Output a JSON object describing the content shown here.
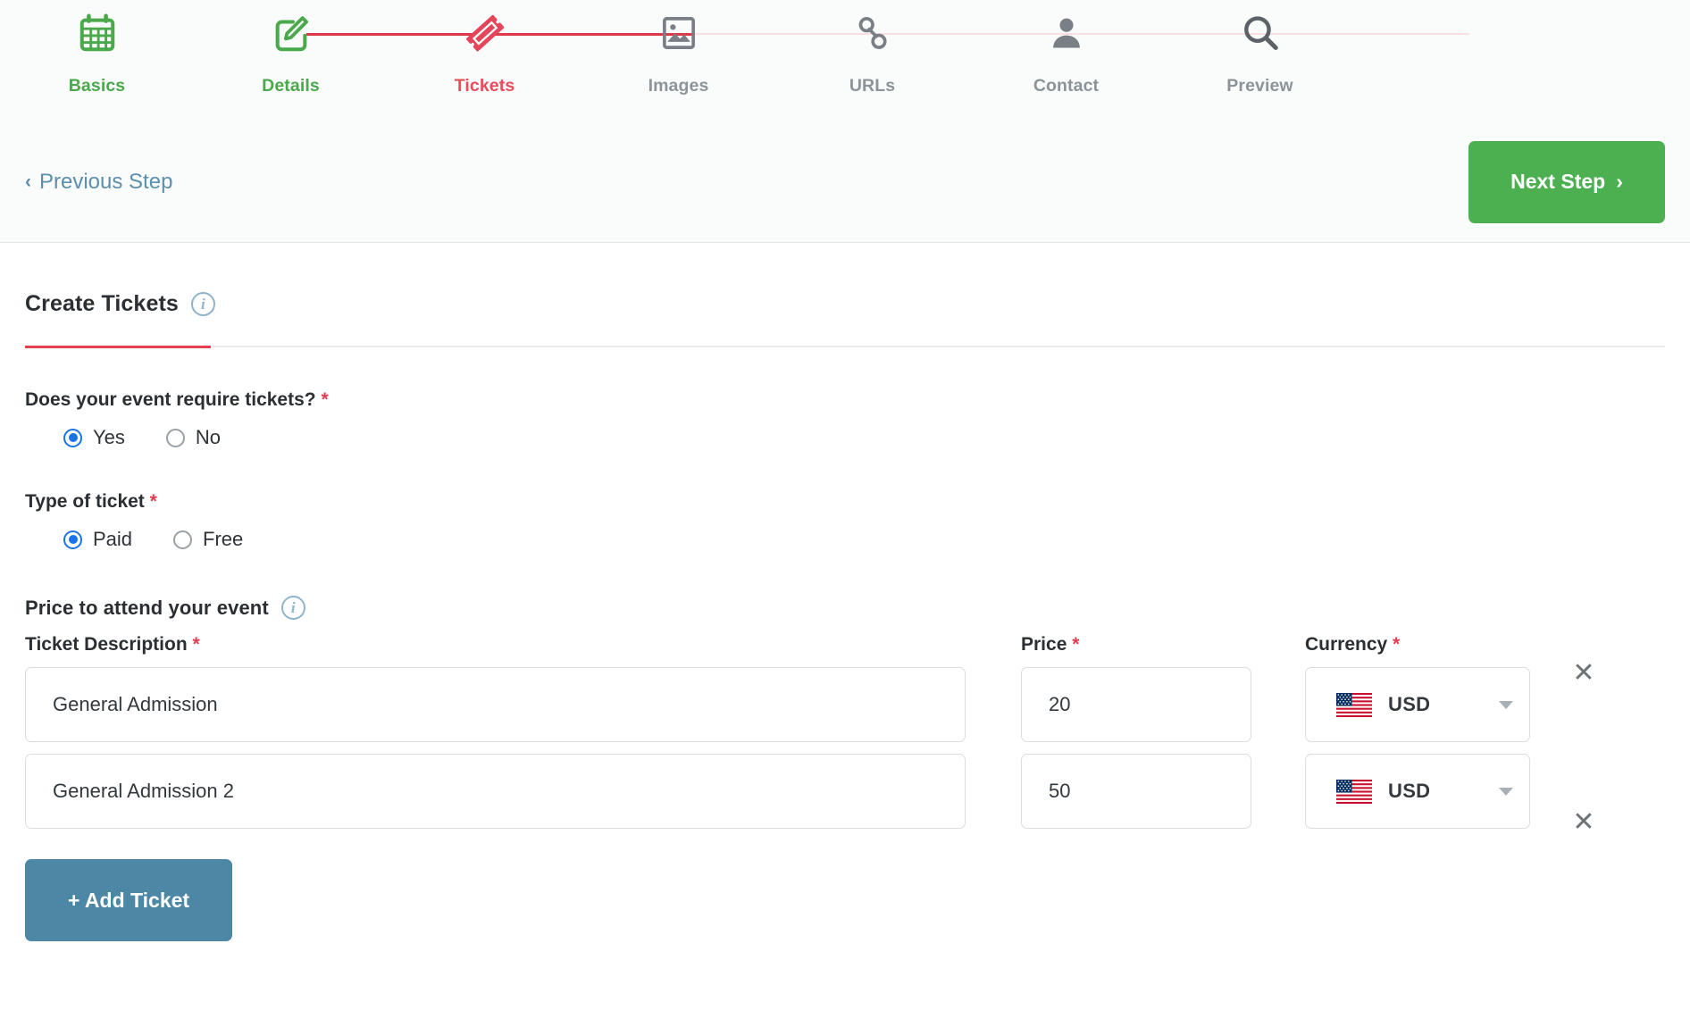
{
  "stepper": {
    "steps": [
      {
        "label": "Basics",
        "icon": "calendar-icon",
        "state": "done"
      },
      {
        "label": "Details",
        "icon": "edit-square-icon",
        "state": "done"
      },
      {
        "label": "Tickets",
        "icon": "ticket-icon",
        "state": "active"
      },
      {
        "label": "Images",
        "icon": "image-icon",
        "state": "todo"
      },
      {
        "label": "URLs",
        "icon": "link-chain-icon",
        "state": "todo"
      },
      {
        "label": "Contact",
        "icon": "person-icon",
        "state": "todo"
      },
      {
        "label": "Preview",
        "icon": "magnifier-icon",
        "state": "todo"
      }
    ],
    "colors": {
      "done": "#4aa94a",
      "active": "#ea4b5a",
      "todo": "#8d9499",
      "connector_done": "#dc3a4b",
      "connector_todo": "#fbdfe2"
    }
  },
  "nav": {
    "previous_label": "Previous Step",
    "previous_chevron": "‹",
    "next_label": "Next Step",
    "next_chevron": "›",
    "next_color": "#4caf50",
    "previous_color": "#5b8fae"
  },
  "section": {
    "title": "Create Tickets",
    "info_glyph": "i"
  },
  "questions": {
    "requires_tickets": {
      "label": "Does your event require tickets?",
      "required_mark": "*",
      "options": [
        {
          "label": "Yes",
          "checked": true
        },
        {
          "label": "No",
          "checked": false
        }
      ]
    },
    "ticket_type": {
      "label": "Type of ticket",
      "required_mark": "*",
      "options": [
        {
          "label": "Paid",
          "checked": true
        },
        {
          "label": "Free",
          "checked": false
        }
      ]
    }
  },
  "price_section": {
    "title": "Price to attend your event",
    "info_glyph": "i",
    "columns": {
      "description": "Ticket Description",
      "description_required": "*",
      "price": "Price",
      "price_required": "*",
      "currency": "Currency",
      "currency_required": "*"
    },
    "rows": [
      {
        "description": "General Admission",
        "description_placeholder": "",
        "price": "20",
        "price_placeholder": "",
        "currency": "USD",
        "currency_flag": "us-flag-icon",
        "delete_glyph": "✕"
      },
      {
        "description": "General Admission 2",
        "description_placeholder": "",
        "price": "50",
        "price_placeholder": "",
        "currency": "USD",
        "currency_flag": "us-flag-icon",
        "delete_glyph": "✕"
      }
    ],
    "add_ticket_label": "+ Add Ticket",
    "add_ticket_color": "#4c88a6"
  }
}
